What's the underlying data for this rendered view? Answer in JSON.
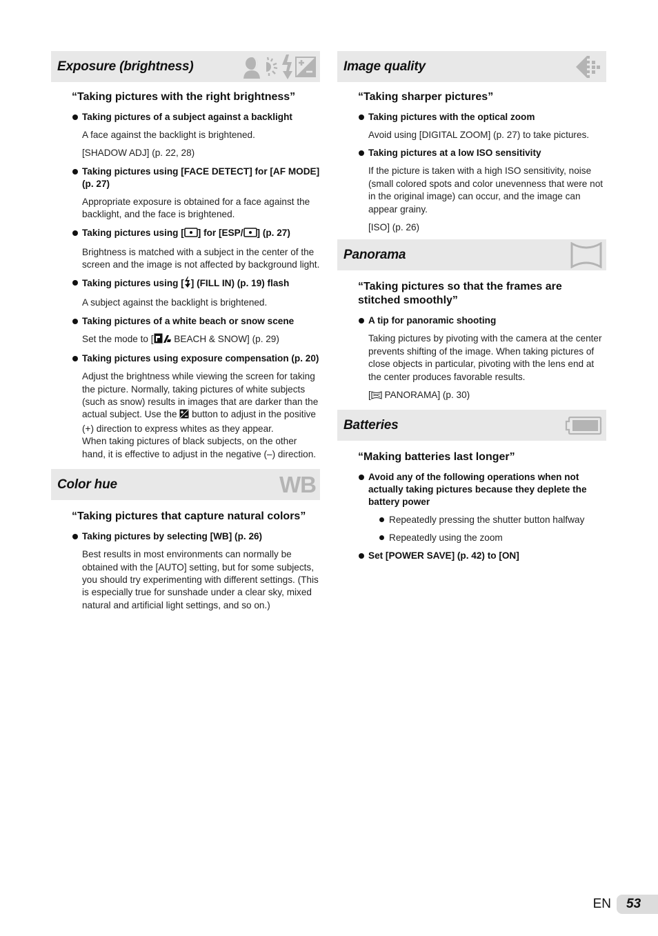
{
  "sections": {
    "exposure": {
      "title": "Exposure (brightness)",
      "icons": [
        "backlight-face-icon",
        "sun-icon",
        "flash-icon",
        "exposure-compensation-icon"
      ],
      "subhead": "“Taking pictures with the right brightness”",
      "items": [
        {
          "heading": "Taking pictures of a subject against a backlight",
          "paras": [
            "A face against the backlight is brightened.",
            "[SHADOW ADJ] (p. 22, 28)"
          ]
        },
        {
          "heading": "Taking pictures using [FACE DETECT] for [AF MODE] (p. 27)",
          "paras": [
            "Appropriate exposure is obtained for a face against the backlight, and the face is brightened."
          ]
        },
        {
          "heading_parts": [
            "Taking pictures using [",
            "] for [ESP/",
            "] (p. 27)"
          ],
          "paras": [
            "Brightness is matched with a subject in the center of the screen and the image is not affected by background light."
          ]
        },
        {
          "heading_parts": [
            "Taking pictures using [",
            "] (FILL IN) (p. 19) flash"
          ],
          "paras": [
            "A subject against the backlight is brightened."
          ]
        },
        {
          "heading": "Taking pictures of a white beach or snow scene",
          "para_parts": [
            "Set the mode to [",
            " BEACH & SNOW] (p. 29)"
          ]
        },
        {
          "heading": "Taking pictures using exposure compensation (p. 20)",
          "para_parts": [
            "Adjust the brightness while viewing the screen for taking the picture. Normally, taking pictures of white subjects (such as snow) results in images that are darker than the actual subject. Use the ",
            " button to adjust in the positive (+) direction to express whites as they appear."
          ],
          "para2": "When taking pictures of black subjects, on the other hand, it is effective to adjust in the negative (–) direction."
        }
      ]
    },
    "color_hue": {
      "title": "Color hue",
      "icon_text": "WB",
      "subhead": "“Taking pictures that capture natural colors”",
      "items": [
        {
          "heading": "Taking pictures by selecting [WB] (p. 26)",
          "paras": [
            "Best results in most environments can normally be obtained with the [AUTO] setting, but for some subjects, you should try experimenting with different settings. (This is especially true for sunshade under a clear sky, mixed natural and artificial light settings, and so on.)"
          ]
        }
      ]
    },
    "image_quality": {
      "title": "Image quality",
      "subhead": "“Taking sharper pictures”",
      "items": [
        {
          "heading": "Taking pictures with the optical zoom",
          "paras": [
            "Avoid using [DIGITAL ZOOM] (p. 27) to take pictures."
          ]
        },
        {
          "heading": "Taking pictures at a low ISO sensitivity",
          "paras": [
            "If the picture is taken with a high ISO sensitivity, noise (small colored spots and color unevenness that were not in the original image) can occur, and the image can appear grainy.",
            "[ISO] (p. 26)"
          ]
        }
      ]
    },
    "panorama": {
      "title": "Panorama",
      "subhead": "“Taking pictures so that the frames are stitched smoothly”",
      "items": [
        {
          "heading": "A tip for panoramic shooting",
          "paras": [
            "Taking pictures by pivoting with the camera at the center prevents shifting of the image. When taking pictures of close objects in particular, pivoting with the lens end at the center produces favorable results."
          ],
          "ref_parts": [
            "[",
            " PANORAMA] (p. 30)"
          ]
        }
      ]
    },
    "batteries": {
      "title": "Batteries",
      "subhead": "“Making batteries last longer”",
      "items": [
        {
          "heading": "Avoid any of the following operations when not actually taking pictures because they deplete the battery power",
          "sub_items": [
            "Repeatedly pressing the shutter button halfway",
            "Repeatedly using the zoom"
          ]
        },
        {
          "heading": "Set [POWER SAVE] (p. 42) to [ON]"
        }
      ]
    }
  },
  "footer": {
    "lang": "EN",
    "page": "53"
  },
  "colors": {
    "header_bg": "#e8e8e8",
    "icon_gray": "#b4b4b4",
    "page_tab": "#dcdcdc"
  }
}
